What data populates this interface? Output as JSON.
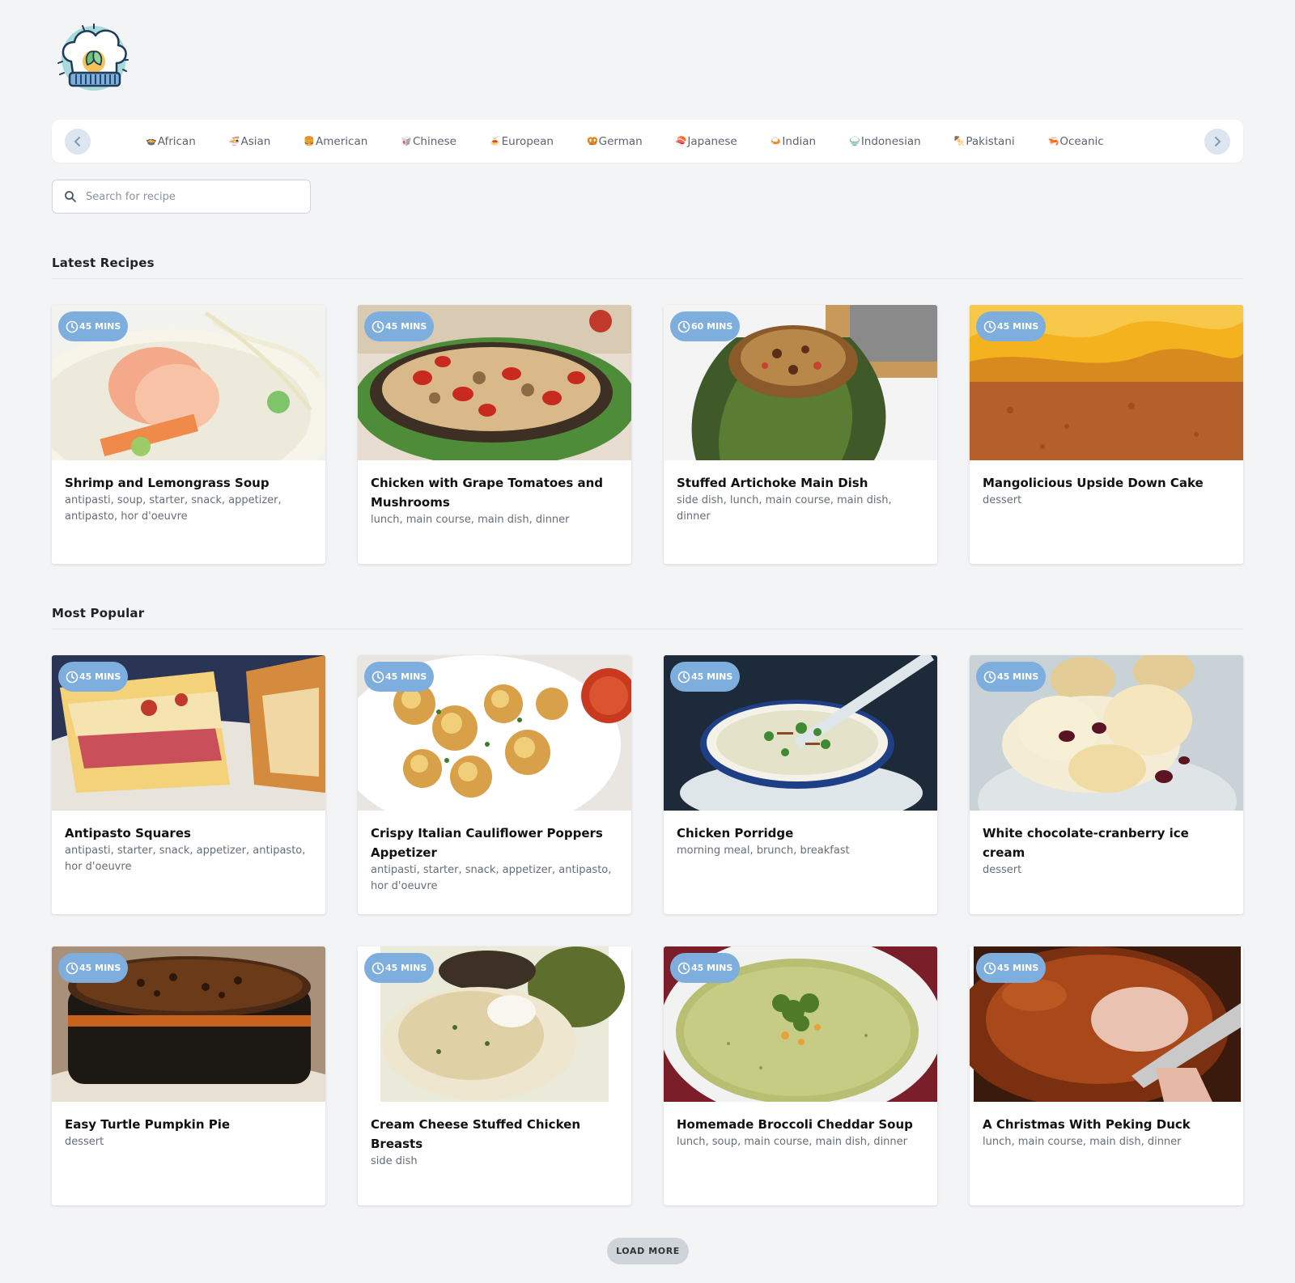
{
  "logo": {
    "icon": "chef-hat-logo-icon"
  },
  "cuisines": [
    "African",
    "Asian",
    "American",
    "Chinese",
    "European",
    "German",
    "Japanese",
    "Indian",
    "Indonesian",
    "Pakistani",
    "Oceanic"
  ],
  "search": {
    "placeholder": "Search for recipe"
  },
  "sections": {
    "latest": "Latest Recipes",
    "popular": "Most Popular"
  },
  "latest_recipes": [
    {
      "time": "45 MINS",
      "title": "Shrimp and Lemongrass Soup",
      "tags": "antipasti, soup, starter, snack, appetizer, antipasto, hor d'oeuvre"
    },
    {
      "time": "45 MINS",
      "title": "Chicken with Grape Tomatoes and Mushrooms",
      "tags": "lunch, main course, main dish, dinner"
    },
    {
      "time": "60 MINS",
      "title": "Stuffed Artichoke Main Dish",
      "tags": "side dish, lunch, main course, main dish, dinner"
    },
    {
      "time": "45 MINS",
      "title": "Mangolicious Upside Down Cake",
      "tags": "dessert"
    }
  ],
  "popular_recipes": [
    {
      "time": "45 MINS",
      "title": "Antipasto Squares",
      "tags": "antipasti, starter, snack, appetizer, antipasto, hor d'oeuvre"
    },
    {
      "time": "45 MINS",
      "title": "Crispy Italian Cauliflower Poppers Appetizer",
      "tags": "antipasti, starter, snack, appetizer, antipasto, hor d'oeuvre"
    },
    {
      "time": "45 MINS",
      "title": "Chicken Porridge",
      "tags": "morning meal, brunch, breakfast"
    },
    {
      "time": "45 MINS",
      "title": "White chocolate-cranberry ice cream",
      "tags": "dessert"
    },
    {
      "time": "45 MINS",
      "title": "Easy Turtle Pumpkin Pie",
      "tags": "dessert"
    },
    {
      "time": "45 MINS",
      "title": "Cream Cheese Stuffed Chicken Breasts",
      "tags": "side dish"
    },
    {
      "time": "45 MINS",
      "title": "Homemade Broccoli Cheddar Soup",
      "tags": "lunch, soup, main course, main dish, dinner"
    },
    {
      "time": "45 MINS",
      "title": "A Christmas With Peking Duck",
      "tags": "lunch, main course, main dish, dinner"
    }
  ],
  "load_more": "LOAD MORE",
  "colors": {
    "badge": "#7eaede",
    "background": "#f3f4f6",
    "load_more": "#cfd3da"
  }
}
